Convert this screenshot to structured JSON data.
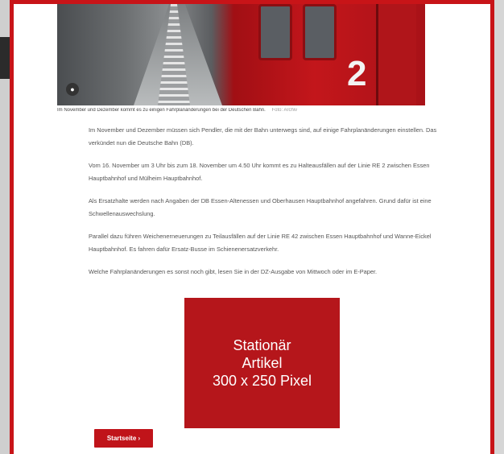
{
  "hero_image": {
    "badge_icon": "camera-icon",
    "train_number": "2",
    "caption": "Im November und Dezember kommt es zu einigen Fahrplanänderungen bei der Deutschen Bahn.",
    "credit": "Foto: Archiv"
  },
  "article": {
    "paragraphs": [
      "Im November und Dezember müssen sich Pendler, die mit der Bahn unterwegs sind, auf einige Fahrplanänderungen einstellen. Das verkündet nun die Deutsche Bahn (DB).",
      "Vom 16. November um 3 Uhr bis zum 18. November um 4.50 Uhr kommt es zu Halteausfällen auf der Linie RE 2 zwischen Essen Hauptbahnhof und Mülheim Hauptbahnhof.",
      "Als Ersatzhalte werden nach Angaben der DB Essen-Altenessen und Oberhausen Hauptbahnhof angefahren. Grund dafür ist eine Schwellenauswechslung.",
      "Parallel dazu führen Weichenerneuerungen zu Teilausfällen auf der Linie RE 42 zwischen Essen Hauptbahnhof und Wanne-Eickel Hauptbahnhof. Es fahren dafür Ersatz-Busse im Schienenersatzverkehr.",
      "Welche Fahrplanänderungen es sonst noch gibt, lesen Sie in der DZ-Ausgabe von Mittwoch oder im E-Paper."
    ]
  },
  "ad": {
    "line1": "Stationär",
    "line2": "Artikel",
    "line3": "300 x 250 Pixel"
  },
  "start_button": {
    "label": "Startseite ›"
  },
  "colors": {
    "accent": "#c81418",
    "ad_background": "#b5161b"
  }
}
